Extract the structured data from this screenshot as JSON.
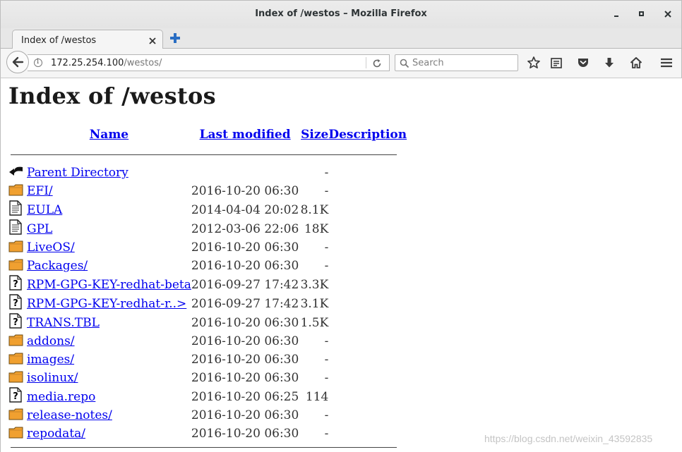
{
  "window": {
    "title": "Index of /westos – Mozilla Firefox"
  },
  "tab": {
    "title": "Index of /westos"
  },
  "navbar": {
    "url_host": "172.25.254.100",
    "url_path": "/westos/",
    "search_placeholder": "Search"
  },
  "page": {
    "heading": "Index of /westos",
    "columns": {
      "name": "Name",
      "last_modified": "Last modified",
      "size": "Size",
      "description": "Description"
    },
    "rows": [
      {
        "icon": "back-icon",
        "name": "Parent Directory",
        "date": "",
        "size": "-"
      },
      {
        "icon": "folder-icon",
        "name": "EFI/",
        "date": "2016-10-20 06:30",
        "size": "-"
      },
      {
        "icon": "text-file-icon",
        "name": "EULA",
        "date": "2014-04-04 20:02",
        "size": "8.1K"
      },
      {
        "icon": "text-file-icon",
        "name": "GPL",
        "date": "2012-03-06 22:06",
        "size": "18K"
      },
      {
        "icon": "folder-icon",
        "name": "LiveOS/",
        "date": "2016-10-20 06:30",
        "size": "-"
      },
      {
        "icon": "folder-icon",
        "name": "Packages/",
        "date": "2016-10-20 06:30",
        "size": "-"
      },
      {
        "icon": "unknown-file-icon",
        "name": "RPM-GPG-KEY-redhat-beta",
        "date": "2016-09-27 17:42",
        "size": "3.3K"
      },
      {
        "icon": "unknown-file-icon",
        "name": "RPM-GPG-KEY-redhat-r..>",
        "date": "2016-09-27 17:42",
        "size": "3.1K"
      },
      {
        "icon": "unknown-file-icon",
        "name": "TRANS.TBL",
        "date": "2016-10-20 06:30",
        "size": "1.5K"
      },
      {
        "icon": "folder-icon",
        "name": "addons/",
        "date": "2016-10-20 06:30",
        "size": "-"
      },
      {
        "icon": "folder-icon",
        "name": "images/",
        "date": "2016-10-20 06:30",
        "size": "-"
      },
      {
        "icon": "folder-icon",
        "name": "isolinux/",
        "date": "2016-10-20 06:30",
        "size": "-"
      },
      {
        "icon": "unknown-file-icon",
        "name": "media.repo",
        "date": "2016-10-20 06:25",
        "size": "114"
      },
      {
        "icon": "folder-icon",
        "name": "release-notes/",
        "date": "2016-10-20 06:30",
        "size": "-"
      },
      {
        "icon": "folder-icon",
        "name": "repodata/",
        "date": "2016-10-20 06:30",
        "size": "-"
      }
    ]
  },
  "watermark": "https://blog.csdn.net/weixin_43592835",
  "colors": {
    "link": "#0000ee",
    "folder": "#f0a030",
    "accent_plus": "#2a6ec3"
  }
}
